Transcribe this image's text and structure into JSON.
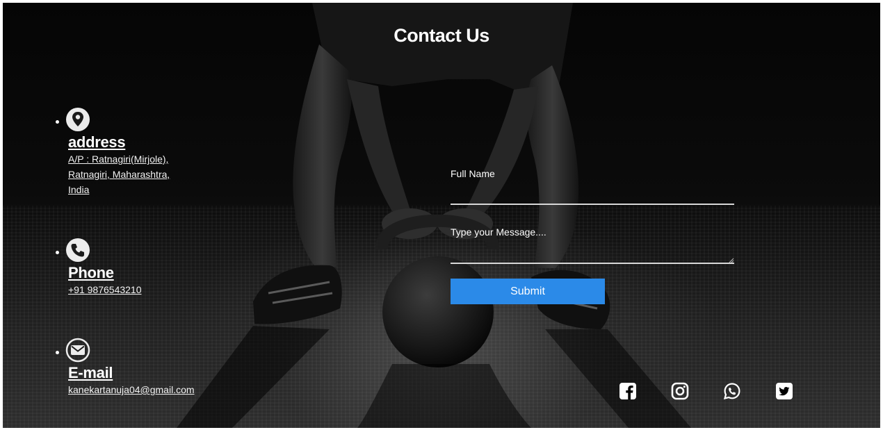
{
  "page": {
    "title": "Contact Us"
  },
  "contact": {
    "address": {
      "icon": "map-pin-icon",
      "heading": "address",
      "lines": [
        "A/P : Ratnagiri(Mirjole),",
        "Ratnagiri, Maharashtra,",
        "India"
      ]
    },
    "phone": {
      "icon": "phone-icon",
      "heading": "Phone",
      "value": "+91 9876543210"
    },
    "email": {
      "icon": "envelope-icon",
      "heading": "E-mail",
      "value": "kanekartanuja04@gmail.com"
    }
  },
  "form": {
    "name_placeholder": "Full Name",
    "message_placeholder": "Type your Message....",
    "submit_label": "Submit",
    "accent": "#2b8ae8"
  },
  "social": [
    {
      "icon": "facebook-icon"
    },
    {
      "icon": "instagram-icon"
    },
    {
      "icon": "whatsapp-icon"
    },
    {
      "icon": "twitter-icon"
    }
  ]
}
